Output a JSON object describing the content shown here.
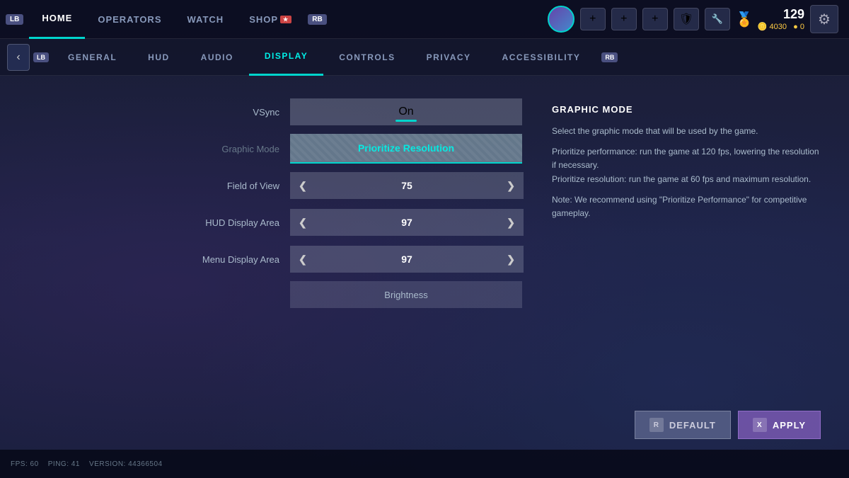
{
  "topNav": {
    "lb_label": "LB",
    "items": [
      {
        "id": "home",
        "label": "HOME",
        "active": false
      },
      {
        "id": "operators",
        "label": "OPERATORS",
        "active": false
      },
      {
        "id": "watch",
        "label": "WATCH",
        "active": false
      },
      {
        "id": "shop",
        "label": "SHOP",
        "active": false,
        "badge": "★"
      }
    ],
    "rb_label": "RB",
    "score": "129",
    "currency_icon": "🏅",
    "gold": "4030",
    "silver": "0"
  },
  "tabs": {
    "lb_label": "LB",
    "rb_label": "RB",
    "items": [
      {
        "id": "general",
        "label": "GENERAL",
        "active": false
      },
      {
        "id": "hud",
        "label": "HUD",
        "active": false
      },
      {
        "id": "audio",
        "label": "AUDIO",
        "active": false
      },
      {
        "id": "display",
        "label": "DISPLAY",
        "active": true
      },
      {
        "id": "controls",
        "label": "CONTROLS",
        "active": false
      },
      {
        "id": "privacy",
        "label": "PRIVACY",
        "active": false
      },
      {
        "id": "accessibility",
        "label": "ACCESSIBILITY",
        "active": false
      }
    ]
  },
  "settings": {
    "vsync": {
      "label": "VSync",
      "value": "On"
    },
    "graphicMode": {
      "label": "Graphic Mode",
      "value": "Prioritize Resolution"
    },
    "fieldOfView": {
      "label": "Field of View",
      "value": "75"
    },
    "hudDisplayArea": {
      "label": "HUD Display Area",
      "value": "97"
    },
    "menuDisplayArea": {
      "label": "Menu Display Area",
      "value": "97"
    },
    "brightness": {
      "label": "Brightness"
    }
  },
  "infoPanel": {
    "title": "GRAPHIC MODE",
    "paragraphs": [
      "Select the graphic mode that will be used by the game.",
      "Prioritize performance: run the game at 120 fps, lowering the resolution if necessary.\nPrioritize resolution: run the game at 60 fps and maximum resolution.",
      "Note: We recommend using \"Prioritize Performance\" for competitive gameplay."
    ]
  },
  "buttons": {
    "default": {
      "key": "R",
      "label": "DEFAULT"
    },
    "apply": {
      "key": "X",
      "label": "APPLY"
    }
  },
  "statusBar": {
    "fps": "FPS: 60",
    "ping": "PING: 41",
    "version": "VERSION: 44366504"
  },
  "icons": {
    "back": "‹",
    "gear": "⚙",
    "chevron_left": "❮",
    "chevron_right": "❯",
    "plus": "+",
    "shield": "🛡"
  }
}
